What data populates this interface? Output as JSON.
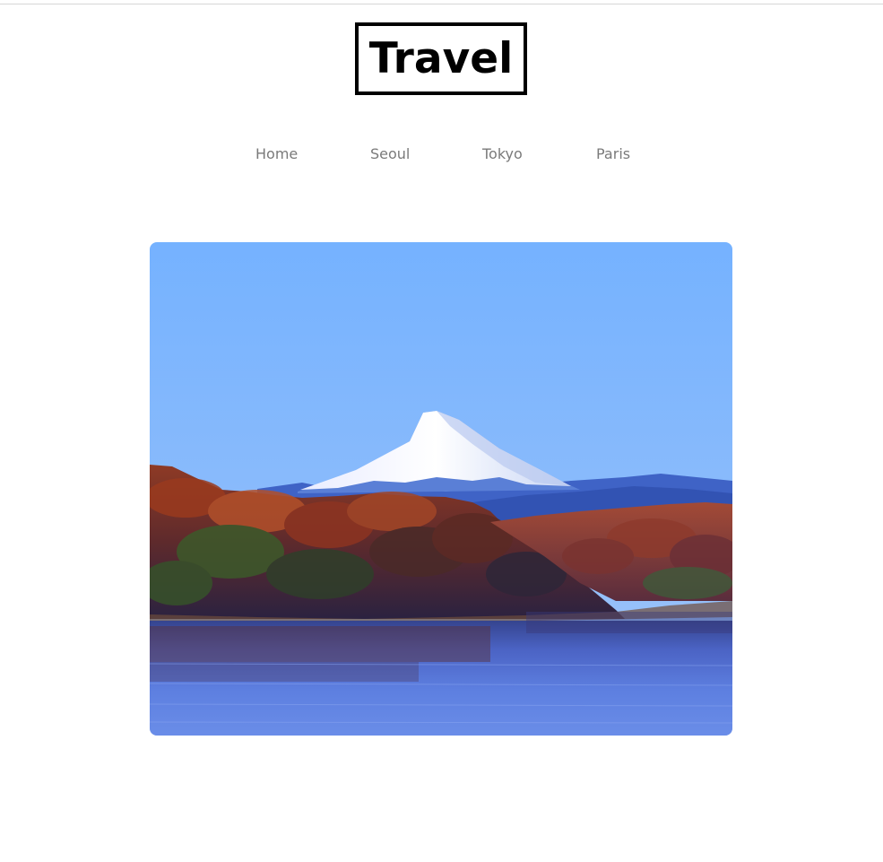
{
  "site": {
    "logo_text": "Travel"
  },
  "nav": {
    "items": [
      {
        "label": "Home"
      },
      {
        "label": "Seoul"
      },
      {
        "label": "Tokyo"
      },
      {
        "label": "Paris"
      }
    ]
  },
  "hero": {
    "image_subject": "mountain-lake-photo"
  },
  "colors": {
    "nav_text": "#7a7a7a",
    "logo_border": "#000000",
    "sky_top": "#7ab4ff",
    "sky_bottom": "#9cc4fb",
    "water": "#5a7fe0"
  }
}
